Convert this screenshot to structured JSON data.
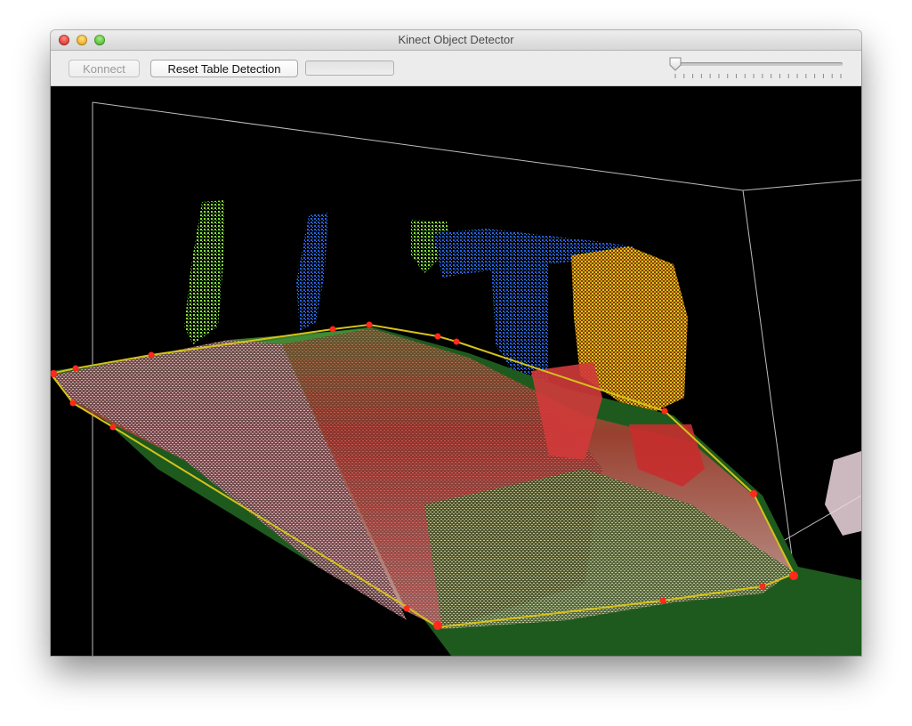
{
  "window": {
    "title": "Kinect Object Detector"
  },
  "toolbar": {
    "connect_label": "Konnect",
    "connect_enabled": false,
    "reset_label": "Reset Table Detection",
    "progress_fraction": 0,
    "slider_fraction": 0
  },
  "scene": {
    "background_color": "#000000",
    "table_plane_color": "#1e5a1e",
    "hull_color": "#d4c21a",
    "hull_vertex_color": "#ff2a1a",
    "bounding_box_color": "#bdbdbd"
  }
}
